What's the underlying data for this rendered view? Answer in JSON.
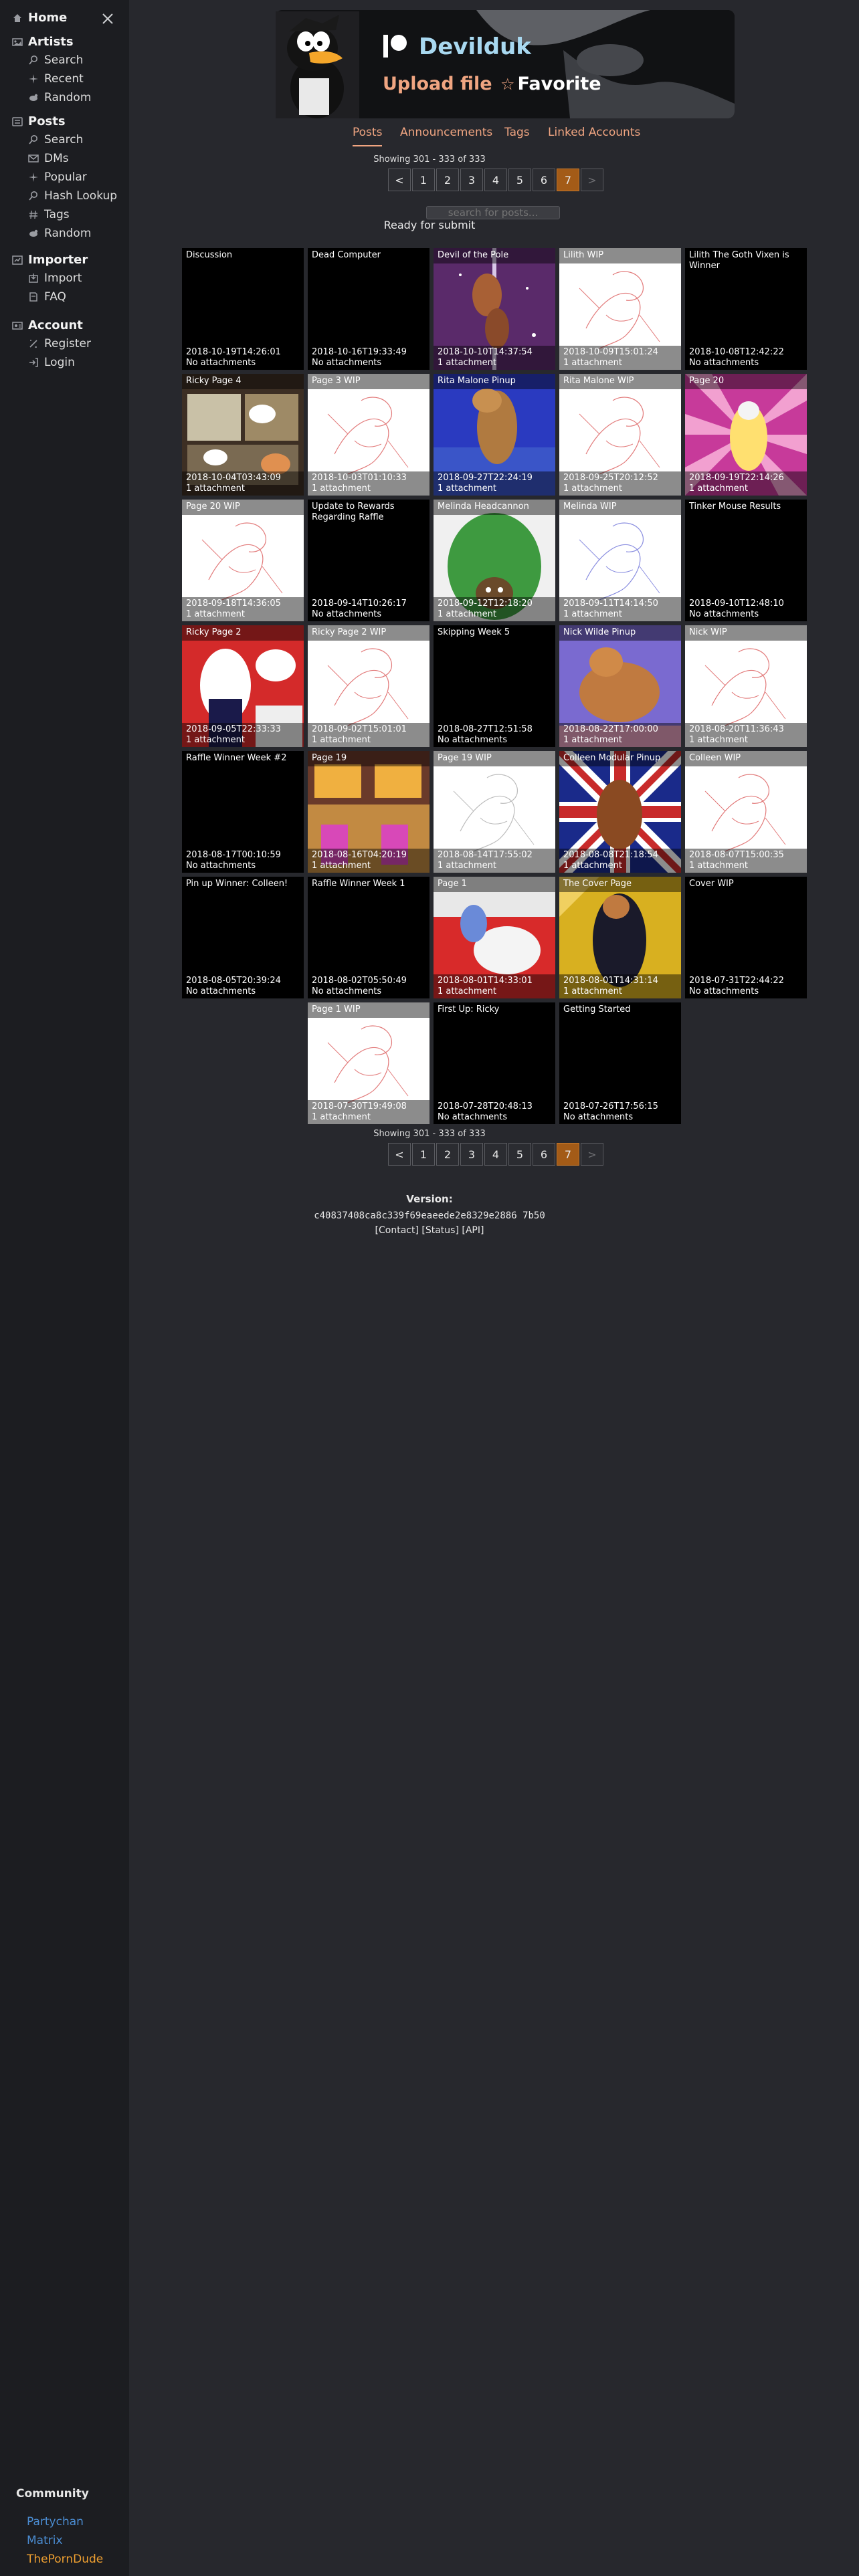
{
  "sidebar": {
    "home": "Home",
    "sections": [
      {
        "title": "Artists",
        "items": [
          "Search",
          "Recent",
          "Random"
        ]
      },
      {
        "title": "Posts",
        "items": [
          "Search",
          "DMs",
          "Popular",
          "Hash Lookup",
          "Tags",
          "Random"
        ]
      },
      {
        "title": "Importer",
        "items": [
          "Import",
          "FAQ"
        ]
      },
      {
        "title": "Account",
        "items": [
          "Register",
          "Login"
        ]
      }
    ],
    "community": {
      "title": "Community",
      "links": [
        {
          "label": "Partychan",
          "color": "#4a8bd0"
        },
        {
          "label": "Matrix",
          "color": "#4a8bd0"
        },
        {
          "label": "ThePornDude",
          "color": "#f0a030"
        }
      ]
    }
  },
  "artist": {
    "name": "Devilduk",
    "upload": "Upload file",
    "favorite": "Favorite",
    "name_color": "#a8d8f0",
    "accent": "#f0a581"
  },
  "tabs": [
    {
      "label": "Posts",
      "active": true
    },
    {
      "label": "Announcements",
      "active": false
    },
    {
      "label": "Tags",
      "active": false
    },
    {
      "label": "Linked Accounts",
      "active": false
    }
  ],
  "showing": "Showing 301 - 333 of 333",
  "pager": [
    "<",
    "1",
    "2",
    "3",
    "4",
    "5",
    "6",
    "7",
    ">"
  ],
  "pager_current": "7",
  "search_placeholder": "search for posts...",
  "ready": "Ready for submit",
  "posts": [
    {
      "title": "Discussion",
      "date": "2018-10-19T14:26:01",
      "attach": "No attachments",
      "img": null
    },
    {
      "title": "Dead Computer",
      "date": "2018-10-16T19:33:49",
      "attach": "No attachments",
      "img": null
    },
    {
      "title": "Devil of the Pole",
      "date": "2018-10-10T14:37:54",
      "attach": "1 attachment",
      "img": "pole"
    },
    {
      "title": "Lilith WIP",
      "date": "2018-10-09T15:01:24",
      "attach": "1 attachment",
      "img": "sketch"
    },
    {
      "title": "Lilith The Goth Vixen is Winner",
      "date": "2018-10-08T12:42:22",
      "attach": "No attachments",
      "img": null
    },
    {
      "title": "Ricky Page 4",
      "date": "2018-10-04T03:43:09",
      "attach": "1 attachment",
      "img": "comic"
    },
    {
      "title": "Page 3 WIP",
      "date": "2018-10-03T01:10:33",
      "attach": "1 attachment",
      "img": "sketch"
    },
    {
      "title": "Rita Malone Pinup",
      "date": "2018-09-27T22:24:19",
      "attach": "1 attachment",
      "img": "rita"
    },
    {
      "title": "Rita Malone WIP",
      "date": "2018-09-25T20:12:52",
      "attach": "1 attachment",
      "img": "sketch"
    },
    {
      "title": "Page 20",
      "date": "2018-09-19T22:14:26",
      "attach": "1 attachment",
      "img": "page20"
    },
    {
      "title": "Page 20 WIP",
      "date": "2018-09-18T14:36:05",
      "attach": "1 attachment",
      "img": "sketch"
    },
    {
      "title": "Update to Rewards Regarding Raffle",
      "date": "2018-09-14T10:26:17",
      "attach": "No attachments",
      "img": null
    },
    {
      "title": "Melinda Headcannon",
      "date": "2018-09-12T12:18:20",
      "attach": "1 attachment",
      "img": "melinda"
    },
    {
      "title": "Melinda WIP",
      "date": "2018-09-11T14:14:50",
      "attach": "1 attachment",
      "img": "sketchblue"
    },
    {
      "title": "Tinker Mouse Results",
      "date": "2018-09-10T12:48:10",
      "attach": "No attachments",
      "img": null
    },
    {
      "title": "Ricky Page 2",
      "date": "2018-09-05T22:33:33",
      "attach": "1 attachment",
      "img": "ricky2"
    },
    {
      "title": "Ricky Page 2 WIP",
      "date": "2018-09-02T15:01:01",
      "attach": "1 attachment",
      "img": "sketch"
    },
    {
      "title": "Skipping Week 5",
      "date": "2018-08-27T12:51:58",
      "attach": "No attachments",
      "img": null
    },
    {
      "title": "Nick Wilde Pinup",
      "date": "2018-08-22T17:00:00",
      "attach": "1 attachment",
      "img": "nick"
    },
    {
      "title": "Nick WIP",
      "date": "2018-08-20T11:36:43",
      "attach": "1 attachment",
      "img": "sketch"
    },
    {
      "title": "Raffle Winner Week #2",
      "date": "2018-08-17T00:10:59",
      "attach": "No attachments",
      "img": null
    },
    {
      "title": "Page 19",
      "date": "2018-08-16T04:20:19",
      "attach": "1 attachment",
      "img": "page19"
    },
    {
      "title": "Page 19 WIP",
      "date": "2018-08-14T17:55:02",
      "attach": "1 attachment",
      "img": "sketchgray"
    },
    {
      "title": "Colleen Modular Pinup",
      "date": "2018-08-08T21:18:54",
      "attach": "1 attachment",
      "img": "colleen"
    },
    {
      "title": "Colleen WIP",
      "date": "2018-08-07T15:00:35",
      "attach": "1 attachment",
      "img": "sketch"
    },
    {
      "title": "Pin up Winner: Colleen!",
      "date": "2018-08-05T20:39:24",
      "attach": "No attachments",
      "img": null
    },
    {
      "title": "Raffle Winner Week 1",
      "date": "2018-08-02T05:50:49",
      "attach": "No attachments",
      "img": null
    },
    {
      "title": "Page 1",
      "date": "2018-08-01T14:33:01",
      "attach": "1 attachment",
      "img": "page1"
    },
    {
      "title": "The Cover Page",
      "date": "2018-08-01T14:31:14",
      "attach": "1 attachment",
      "img": "cover"
    },
    {
      "title": "Cover WIP",
      "date": "2018-07-31T22:44:22",
      "attach": "No attachments",
      "img": null
    },
    {
      "title": "Page 1 WIP",
      "date": "2018-07-30T19:49:08",
      "attach": "1 attachment",
      "img": "sketch"
    },
    {
      "title": "First Up: Ricky",
      "date": "2018-07-28T20:48:13",
      "attach": "No attachments",
      "img": null
    },
    {
      "title": "Getting Started",
      "date": "2018-07-26T17:56:15",
      "attach": "No attachments",
      "img": null
    }
  ],
  "footer": {
    "version_label": "Version:",
    "version_hash": "c40837408ca8c339f69eaeede2e8329e2886 7b50",
    "links": "[Contact]  [Status]  [API]"
  }
}
